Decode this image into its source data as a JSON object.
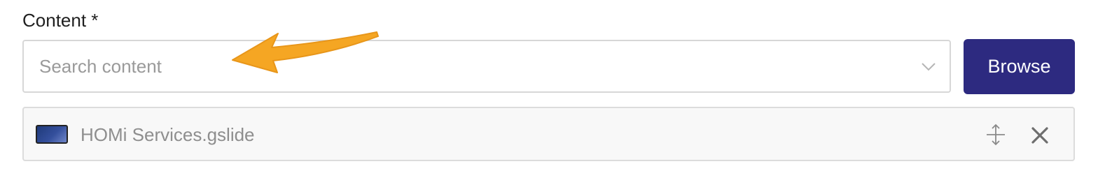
{
  "field": {
    "label": "Content *"
  },
  "search": {
    "value": "",
    "placeholder": "Search content",
    "dropdown_icon": "chevron-down-icon"
  },
  "browse_button": {
    "label": "Browse"
  },
  "selected_item": {
    "name": "HOMi Services.gslide",
    "thumbnail_icon": "slide-thumbnail",
    "move_icon": "vertical-resize-icon",
    "remove_icon": "close-icon"
  },
  "colors": {
    "browse_button_bg": "#2d2a80",
    "annotation_arrow": "#f5a623"
  }
}
